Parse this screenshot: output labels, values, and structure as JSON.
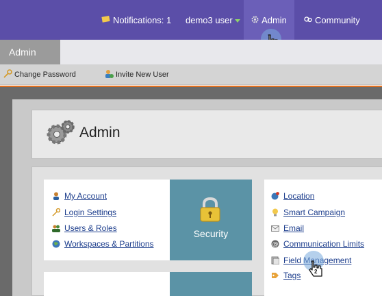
{
  "topbar": {
    "notifications_label": "Notifications: 1",
    "user_label": "demo3 user",
    "admin_label": "Admin",
    "community_label": "Community"
  },
  "tabs": [
    {
      "label": "Admin"
    }
  ],
  "actions": {
    "change_password": "Change Password",
    "invite_user": "Invite New User"
  },
  "page": {
    "title": "Admin"
  },
  "security_card": {
    "links": [
      "My Account",
      "Login Settings",
      "Users & Roles",
      "Workspaces & Partitions"
    ],
    "tile_label": "Security"
  },
  "right_card": {
    "links": [
      "Location",
      "Smart Campaign",
      "Email",
      "Communication Limits",
      "Field Management",
      "Tags"
    ]
  },
  "callouts": {
    "step1": "1",
    "step2": "2"
  },
  "colors": {
    "topbar": "#5b4ea8",
    "tile": "#5b93a6",
    "link": "#1c3d8c"
  }
}
